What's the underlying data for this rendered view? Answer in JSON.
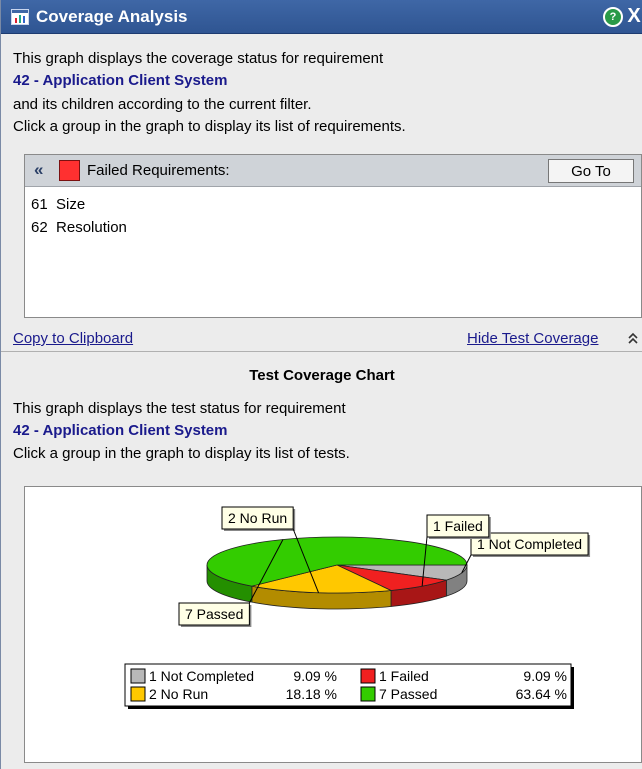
{
  "window": {
    "title": "Coverage Analysis",
    "help_icon": "help-icon",
    "close_label": "X"
  },
  "intro": {
    "line1": "This graph displays the coverage status for requirement",
    "requirement": "42 - Application Client System",
    "line2": "and its children according to the current filter.",
    "line3": "Click a group in the graph to display its list of requirements."
  },
  "requirements_panel": {
    "collapse_label": "«",
    "header_label": "Failed Requirements:",
    "goto_label": "Go To",
    "swatch_color": "#ff3030",
    "items": [
      {
        "label": "61  Size"
      },
      {
        "label": "62  Resolution"
      }
    ]
  },
  "links": {
    "copy": "Copy to Clipboard",
    "hide": "Hide Test Coverage",
    "hide_icon": "»"
  },
  "test_chart": {
    "heading": "Test Coverage Chart",
    "line1": "This graph displays the test status for requirement",
    "requirement": "42 - Application Client System",
    "line2": "Click a group in the graph to display its list of tests."
  },
  "chart_data": {
    "type": "pie",
    "title": "",
    "series": [
      {
        "name": "Not Completed",
        "count": 1,
        "percent": "9.09 %",
        "value": 9.09,
        "color": "#b8b8b8",
        "callout": "1 Not Completed",
        "legend_label": "1 Not Completed"
      },
      {
        "name": "Failed",
        "count": 1,
        "percent": "9.09 %",
        "value": 9.09,
        "color": "#f02020",
        "callout": "1 Failed",
        "legend_label": "1 Failed"
      },
      {
        "name": "No Run",
        "count": 2,
        "percent": "18.18 %",
        "value": 18.18,
        "color": "#ffc800",
        "callout": "2 No Run",
        "legend_label": "2 No Run"
      },
      {
        "name": "Passed",
        "count": 7,
        "percent": "63.64 %",
        "value": 63.64,
        "color": "#33cc00",
        "callout": "7 Passed",
        "legend_label": "7 Passed"
      }
    ],
    "legend_placement": "bottom"
  }
}
